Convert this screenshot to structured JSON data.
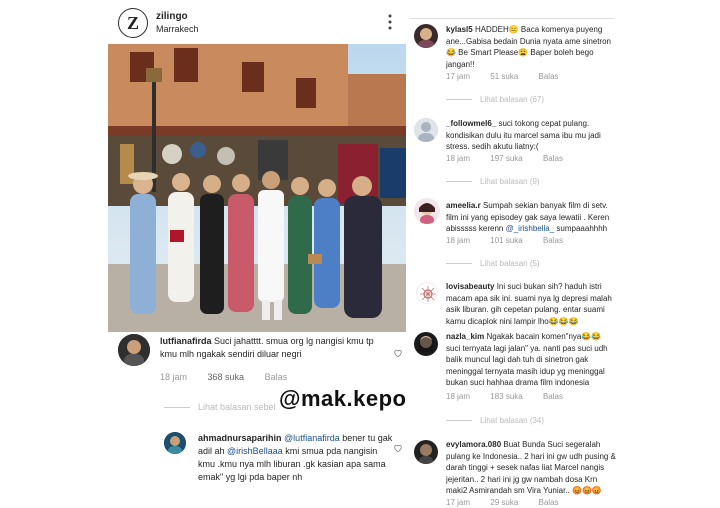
{
  "post": {
    "username": "zilingo",
    "location": "Marrakech",
    "logo_letter": "Z"
  },
  "watermark": "@mak.kepo",
  "left_comments": [
    {
      "user": "lutfianafirda",
      "text": "Suci jahatttt. smua org lg nangisi kmu tp kmu mlh ngakak sendiri diluar negri",
      "time": "18 jam",
      "likes": "368 suka",
      "reply": "Balas",
      "view_replies": "Lihat balasan sebelumnya (10)"
    },
    {
      "user": "ahmadnursaparihin",
      "mentions": "@lutfianafirda",
      "text_1": "bener tu gak adil ah",
      "mention_2": "@irishBellaaa",
      "text_2": "kmi smua pda nangisin kmu .kmu nya mlh liburan .gk kasian apa sama emak\" yg lgi pda baper nh"
    }
  ],
  "right_comments": [
    {
      "user": "kylasl5",
      "text": "HADDEH😑 Baca komenya puyeng ane...Gabisa bedain Dunia nyata ame sinetron😂 Be Smart Please😩 Baper boleh bego jangan!!",
      "time": "17 jam",
      "likes": "51 suka",
      "reply": "Balas",
      "view_replies": "Lihat balasan (67)"
    },
    {
      "user": "_followmel6_",
      "text": "suci tokong cepat pulang. kondisikan dulu itu marcel sama ibu mu jadi stress. sedih akutu liatny:(",
      "time": "18 jam",
      "likes": "197 suka",
      "reply": "Balas",
      "view_replies": "Lihat balasan (9)"
    },
    {
      "user": "ameelia.r",
      "text": "Sumpah sekian banyak film di setv. film ini yang episodey gak saya lewatii . Keren abisssss kerenn",
      "mention": "@_irishbella_",
      "text_end": "sumpaaahhhh",
      "time": "18 jam",
      "likes": "101 suka",
      "reply": "Balas",
      "view_replies": "Lihat balasan (5)"
    },
    {
      "user": "lovisabeauty",
      "text": "Ini suci bukan sih? haduh istri macam apa sik ini. suami nya lg depresi malah asik liburan. gih cepetan pulang. entar suami kamu dicaplok nini lampir lho😂😂😂"
    },
    {
      "user": "nazla_kim",
      "text": "Ngakak bacain komen\"nya😂😂 suci ternyata lagi jalan\" ya. nanti pas suci udh balik muncul lagi dah tuh di sinetron gak meninggal ternyata masih idup yg meninggal bukan suci hahhaa drama film indonesia",
      "time": "18 jam",
      "likes": "183 suka",
      "reply": "Balas",
      "view_replies": "Lihat balasan (34)"
    },
    {
      "user": "evylamora.080",
      "text": "Buat Bunda Suci segeralah pulang ke Indonesia.. 2 hari ini gw udh pusing & darah tinggi + sesek nafas liat Marcel nangis jejeritan.. 2 hari ini jg gw nambah dosa Krn maki2 Asmirandah sm Vira Yuniar.. 😡😡😡",
      "time": "17 jam",
      "likes": "29 suka",
      "reply": "Balas"
    }
  ],
  "colors": {
    "accent_link": "#1a4f8a",
    "meta_grey": "#999999"
  }
}
